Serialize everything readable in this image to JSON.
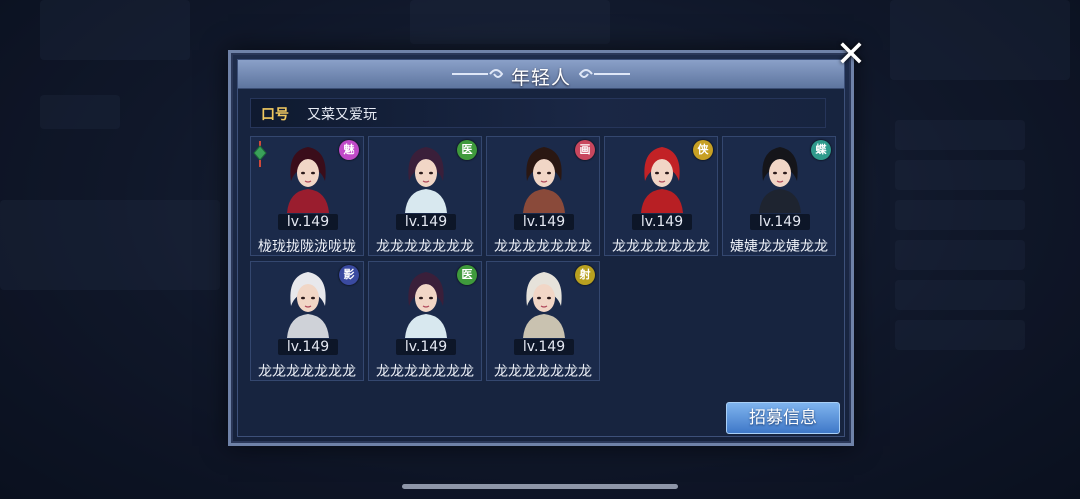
{
  "dialog": {
    "title": "年轻人",
    "close_glyph": "✕",
    "slogan_label": "口号",
    "slogan_value": "又菜又爱玩",
    "recruit_button": "招募信息"
  },
  "members": [
    {
      "level": "lv.149",
      "name": "栊珑拢陇泷咙垅",
      "badge": "魅",
      "badge_color": "#c04ac8",
      "leader": true,
      "robe": "#9a1d2e",
      "hair": "#3a0d1a"
    },
    {
      "level": "lv.149",
      "name": "龙龙龙龙龙龙龙",
      "badge": "医",
      "badge_color": "#3f9a3c",
      "leader": false,
      "robe": "#d8e8ef",
      "hair": "#3a1f3a"
    },
    {
      "level": "lv.149",
      "name": "龙龙龙龙龙龙龙",
      "badge": "画",
      "badge_color": "#c8475e",
      "leader": false,
      "robe": "#8a4a3a",
      "hair": "#2a1712"
    },
    {
      "level": "lv.149",
      "name": "龙龙龙龙龙龙龙",
      "badge": "侠",
      "badge_color": "#c7a024",
      "leader": false,
      "robe": "#b81f24",
      "hair": "#c22226"
    },
    {
      "level": "lv.149",
      "name": "婕婕龙龙婕龙龙",
      "badge": "蝶",
      "badge_color": "#2f9a8c",
      "leader": false,
      "robe": "#1e2430",
      "hair": "#15151a"
    },
    {
      "level": "lv.149",
      "name": "龙龙龙龙龙龙龙",
      "badge": "影",
      "badge_color": "#3a4aa0",
      "leader": false,
      "robe": "#cfd2d8",
      "hair": "#e8e8ec"
    },
    {
      "level": "lv.149",
      "name": "龙龙龙龙龙龙龙",
      "badge": "医",
      "badge_color": "#3f9a3c",
      "leader": false,
      "robe": "#d8e8ef",
      "hair": "#3a1f3a"
    },
    {
      "level": "lv.149",
      "name": "龙龙龙龙龙龙龙",
      "badge": "射",
      "badge_color": "#b8a020",
      "leader": false,
      "robe": "#c9c2b0",
      "hair": "#e6e2da"
    }
  ],
  "leader_icon": "jade-pendant-icon"
}
